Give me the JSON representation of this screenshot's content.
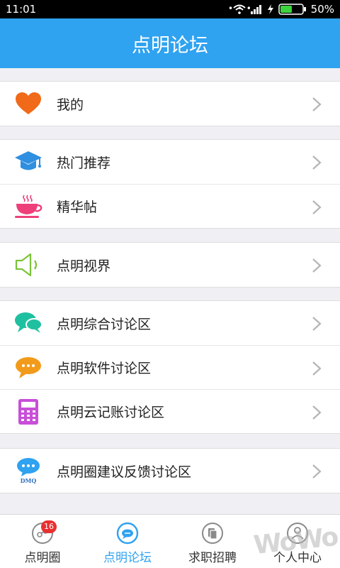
{
  "status": {
    "time": "11:01",
    "battery": "50%"
  },
  "header": {
    "title": "点明论坛"
  },
  "groups": [
    {
      "items": [
        {
          "label": "我的",
          "icon": "heart-icon"
        }
      ]
    },
    {
      "items": [
        {
          "label": "热门推荐",
          "icon": "graduation-cap-icon"
        },
        {
          "label": "精华帖",
          "icon": "coffee-cup-icon"
        }
      ]
    },
    {
      "items": [
        {
          "label": "点明视界",
          "icon": "speaker-icon"
        }
      ]
    },
    {
      "items": [
        {
          "label": "点明综合讨论区",
          "icon": "chat-bubbles-icon"
        },
        {
          "label": "点明软件讨论区",
          "icon": "message-dots-icon"
        },
        {
          "label": "点明云记账讨论区",
          "icon": "calculator-icon"
        }
      ]
    },
    {
      "items": [
        {
          "label": "点明圈建议反馈讨论区",
          "icon": "dmq-feedback-icon",
          "icon_text": "DMQ"
        }
      ]
    }
  ],
  "tabs": [
    {
      "label": "点明圈",
      "badge": "16"
    },
    {
      "label": "点明论坛"
    },
    {
      "label": "求职招聘"
    },
    {
      "label": "个人中心"
    }
  ],
  "watermark": "WoWo",
  "colors": {
    "accent": "#2fa2f0",
    "heart": "#f06a1a",
    "cup": "#ee3f7a",
    "speaker": "#7cc33a",
    "chat": "#1fc0a0",
    "message": "#f29b1a",
    "calculator": "#c84fd8"
  }
}
